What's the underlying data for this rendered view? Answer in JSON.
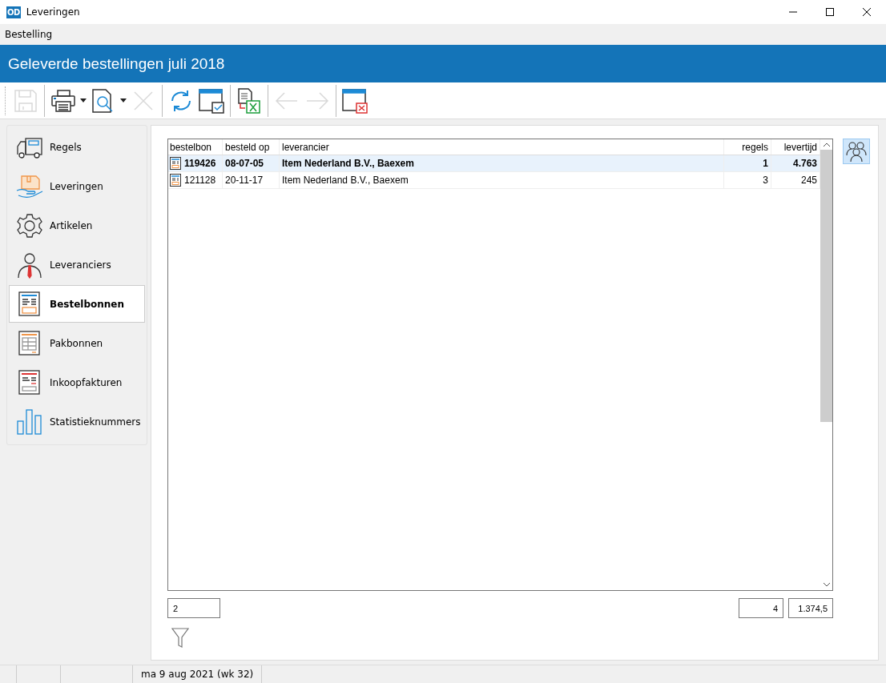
{
  "window": {
    "title": "Leveringen",
    "logo": "OD"
  },
  "menu": [
    "Bestelling"
  ],
  "header": {
    "title": "Geleverde bestellingen juli 2018"
  },
  "toolbar": [
    {
      "buttons": [
        {
          "kind": "save",
          "disabled": true,
          "dropdown": false
        }
      ]
    },
    {
      "buttons": [
        {
          "kind": "print",
          "disabled": false,
          "dropdown": true
        },
        {
          "kind": "preview",
          "disabled": false,
          "dropdown": true
        },
        {
          "kind": "delete",
          "disabled": true,
          "dropdown": false
        }
      ]
    },
    {
      "buttons": [
        {
          "kind": "refresh",
          "disabled": false,
          "dropdown": false
        },
        {
          "kind": "window-check",
          "disabled": false,
          "dropdown": false
        }
      ]
    },
    {
      "buttons": [
        {
          "kind": "export",
          "disabled": false,
          "dropdown": false
        }
      ]
    },
    {
      "buttons": [
        {
          "kind": "back",
          "disabled": true,
          "dropdown": false
        },
        {
          "kind": "forward",
          "disabled": true,
          "dropdown": false
        }
      ]
    },
    {
      "buttons": [
        {
          "kind": "window-close",
          "disabled": false,
          "dropdown": false
        }
      ]
    }
  ],
  "sidebar": {
    "items": [
      {
        "label": "Regels",
        "kind": "truck",
        "selected": false
      },
      {
        "label": "Leveringen",
        "kind": "package",
        "selected": false
      },
      {
        "label": "Artikelen",
        "kind": "gear",
        "selected": false
      },
      {
        "label": "Leveranciers",
        "kind": "person",
        "selected": false
      },
      {
        "label": "Bestelbonnen",
        "kind": "order",
        "selected": true
      },
      {
        "label": "Pakbonnen",
        "kind": "packing",
        "selected": false
      },
      {
        "label": "Inkoopfakturen",
        "kind": "invoice",
        "selected": false
      },
      {
        "label": "Statistieknummers",
        "kind": "chart",
        "selected": false
      }
    ]
  },
  "table": {
    "columns": [
      "bestelbon",
      "besteld op",
      "leverancier",
      "regels",
      "levertijd"
    ],
    "rows": [
      {
        "bestelbon": "119426",
        "besteld_op": "08-07-05",
        "leverancier": "Item Nederland B.V., Baexem",
        "regels": "1",
        "levertijd": "4.763",
        "selected": true
      },
      {
        "bestelbon": "121128",
        "besteld_op": "20-11-17",
        "leverancier": "Item Nederland B.V., Baexem",
        "regels": "3",
        "levertijd": "245",
        "selected": false
      }
    ]
  },
  "footer": {
    "count": "2",
    "total_regels": "4",
    "total_levertijd": "1.374,5"
  },
  "status_bar": {
    "date": "ma 9 aug 2021 (wk 32)"
  }
}
